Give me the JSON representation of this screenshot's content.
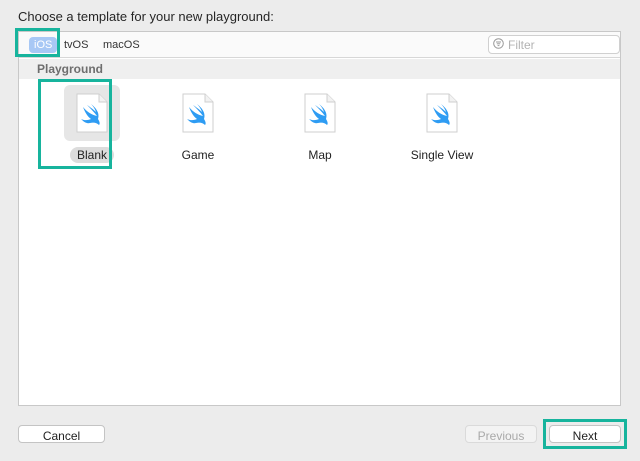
{
  "dialog": {
    "heading": "Choose a template for your new playground:"
  },
  "platforms": [
    {
      "label": "iOS",
      "selected": true
    },
    {
      "label": "tvOS",
      "selected": false
    },
    {
      "label": "macOS",
      "selected": false
    }
  ],
  "filter": {
    "placeholder": "Filter",
    "value": ""
  },
  "section": {
    "title": "Playground"
  },
  "templates": [
    {
      "label": "Blank",
      "icon": "swift-file-icon",
      "selected": true
    },
    {
      "label": "Game",
      "icon": "swift-file-icon",
      "selected": false
    },
    {
      "label": "Map",
      "icon": "swift-file-icon",
      "selected": false
    },
    {
      "label": "Single View",
      "icon": "swift-file-icon",
      "selected": false
    }
  ],
  "buttons": {
    "cancel": "Cancel",
    "previous": "Previous",
    "next": "Next"
  },
  "colors": {
    "accent_highlight": "#17b49d",
    "swift_blue": "#2e9cf3",
    "segment_selected": "#a8c8f5"
  }
}
